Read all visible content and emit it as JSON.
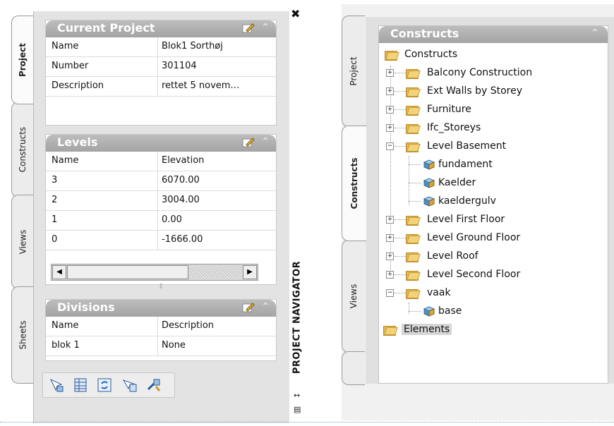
{
  "left_palette": {
    "tabs": [
      "Project",
      "Constructs",
      "Views",
      "Sheets"
    ],
    "active_tab": "Project",
    "current_project": {
      "title": "Current Project",
      "rows": [
        {
          "key": "Name",
          "value": "Blok1 Sorthøj"
        },
        {
          "key": "Number",
          "value": "301104"
        },
        {
          "key": "Description",
          "value": "rettet 5 novem…"
        }
      ]
    },
    "levels": {
      "title": "Levels",
      "columns": [
        "Name",
        "Elevation"
      ],
      "rows": [
        {
          "name": "3",
          "elevation": "6070.00"
        },
        {
          "name": "2",
          "elevation": "3004.00"
        },
        {
          "name": "1",
          "elevation": "0.00"
        },
        {
          "name": "0",
          "elevation": "-1666.00"
        }
      ]
    },
    "divisions": {
      "title": "Divisions",
      "columns": [
        "Name",
        "Description"
      ],
      "rows": [
        {
          "name": "blok 1",
          "description": "None"
        }
      ]
    },
    "vertical_title": "PROJECT NAVIGATOR",
    "toolbar_icons": [
      "select-objects-icon",
      "table-icon",
      "refresh-icon",
      "schedule-icon",
      "tools-icon"
    ]
  },
  "right_palette": {
    "tabs": [
      "Project",
      "Constructs",
      "Views"
    ],
    "active_tab": "Constructs",
    "panel_title": "Constructs",
    "tree": {
      "root": "Constructs",
      "items": [
        {
          "label": "Balcony Construction",
          "type": "folder",
          "expander": "+"
        },
        {
          "label": "Ext Walls by Storey",
          "type": "folder",
          "expander": "+"
        },
        {
          "label": "Furniture",
          "type": "folder",
          "expander": "+"
        },
        {
          "label": "Ifc_Storeys",
          "type": "folder",
          "expander": "+"
        },
        {
          "label": "Level Basement",
          "type": "folder",
          "expander": "−",
          "children": [
            "fundament",
            "Kaelder",
            "kaeldergulv"
          ]
        },
        {
          "label": "Level First Floor",
          "type": "folder",
          "expander": "+"
        },
        {
          "label": "Level Ground Floor",
          "type": "folder",
          "expander": "+"
        },
        {
          "label": "Level Roof",
          "type": "folder",
          "expander": "+"
        },
        {
          "label": "Level Second Floor",
          "type": "folder",
          "expander": "+"
        },
        {
          "label": "vaak",
          "type": "folder",
          "expander": "−",
          "children": [
            "base"
          ]
        }
      ],
      "elements_label": "Elements"
    }
  }
}
